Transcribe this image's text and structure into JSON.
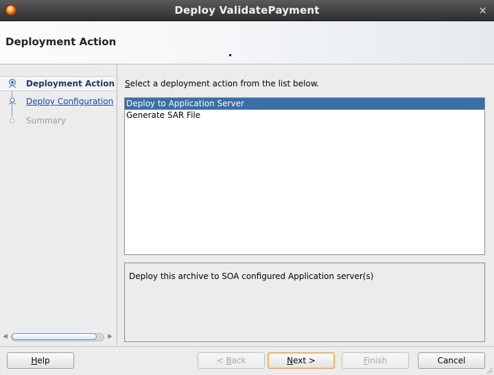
{
  "window": {
    "title": "Deploy ValidatePayment",
    "close_glyph": "×",
    "app_icon": "oracle-jdeveloper-icon"
  },
  "header": {
    "heading": "Deployment Action"
  },
  "nav": {
    "items": [
      {
        "label": "Deployment Action",
        "state": "active"
      },
      {
        "label": "Deploy Configuration",
        "state": "link"
      },
      {
        "label": "Summary",
        "state": "disabled"
      }
    ],
    "scroll_left_glyph": "◀",
    "scroll_right_glyph": "▶"
  },
  "main": {
    "prompt_mnemonic": "S",
    "prompt_rest": "elect a deployment action from the list below.",
    "options": [
      {
        "label": "Deploy to Application Server",
        "selected": true
      },
      {
        "label": "Generate SAR File",
        "selected": false
      }
    ],
    "description": "Deploy this archive to SOA configured Application server(s)"
  },
  "footer": {
    "help": {
      "mnemonic": "H",
      "rest": "elp"
    },
    "back": {
      "prefix": "< ",
      "mnemonic": "B",
      "rest": "ack"
    },
    "next": {
      "mnemonic": "N",
      "rest": "ext >"
    },
    "finish": {
      "mnemonic": "F",
      "rest": "inish"
    },
    "cancel": {
      "label": "Cancel"
    }
  },
  "colors": {
    "selection": "#3a6ea8",
    "link": "#1a44a0",
    "focus": "#e3a23a"
  }
}
